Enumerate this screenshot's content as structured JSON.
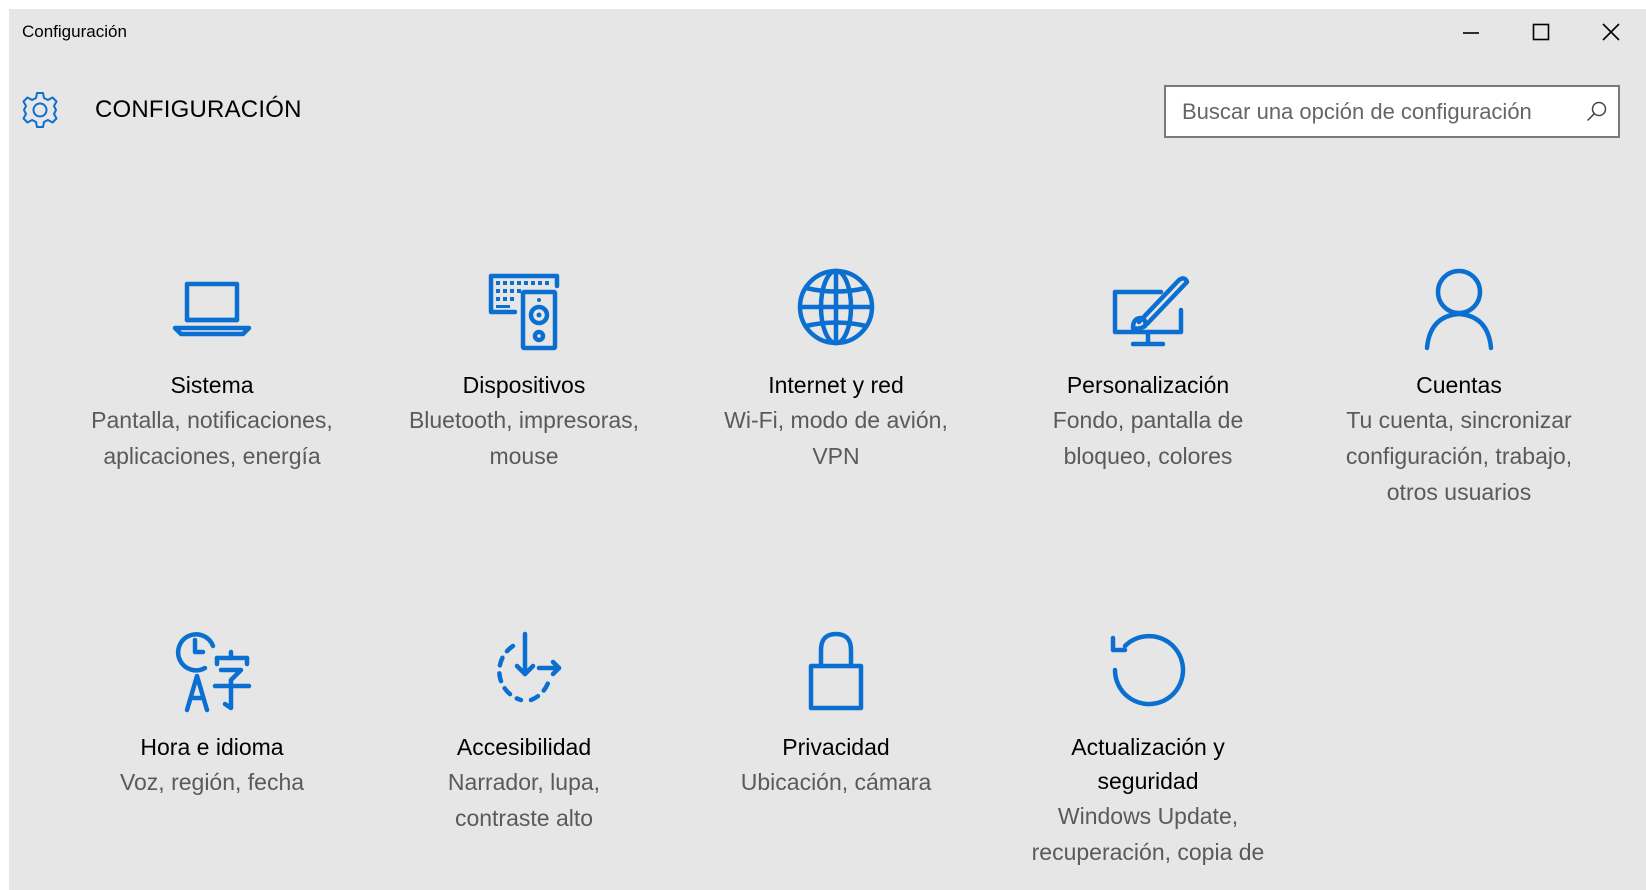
{
  "window": {
    "title": "Configuración",
    "minimize_glyph": "minimize-icon",
    "maximize_glyph": "maximize-icon",
    "close_glyph": "close-icon"
  },
  "header": {
    "icon": "gear-icon",
    "heading": "CONFIGURACIÓN"
  },
  "search": {
    "placeholder": "Buscar una opción de configuración",
    "value": "",
    "icon": "search-icon"
  },
  "accent_color": "#0a6fd0",
  "tiles": [
    {
      "icon": "laptop-icon",
      "title": "Sistema",
      "subtitle": [
        "Pantalla, notificaciones,",
        "aplicaciones, energía"
      ]
    },
    {
      "icon": "devices-icon",
      "title": "Dispositivos",
      "subtitle": [
        "Bluetooth, impresoras,",
        "mouse"
      ]
    },
    {
      "icon": "globe-icon",
      "title": "Internet y red",
      "subtitle": [
        "Wi-Fi, modo de avión,",
        "VPN"
      ]
    },
    {
      "icon": "personalization-icon",
      "title": "Personalización",
      "subtitle": [
        "Fondo, pantalla de",
        "bloqueo, colores"
      ]
    },
    {
      "icon": "person-icon",
      "title": "Cuentas",
      "subtitle": [
        "Tu cuenta, sincronizar",
        "configuración, trabajo,",
        "otros usuarios"
      ]
    },
    {
      "icon": "time-language-icon",
      "title": "Hora e idioma",
      "subtitle": [
        "Voz, región, fecha"
      ]
    },
    {
      "icon": "ease-of-access-icon",
      "title": "Accesibilidad",
      "subtitle": [
        "Narrador, lupa,",
        "contraste alto"
      ]
    },
    {
      "icon": "lock-icon",
      "title": "Privacidad",
      "subtitle": [
        "Ubicación, cámara"
      ]
    },
    {
      "icon": "update-icon",
      "title": "Actualización y seguridad",
      "title_lines": [
        "Actualización y",
        "seguridad"
      ],
      "subtitle": [
        "Windows Update,",
        "recuperación, copia de"
      ]
    }
  ]
}
